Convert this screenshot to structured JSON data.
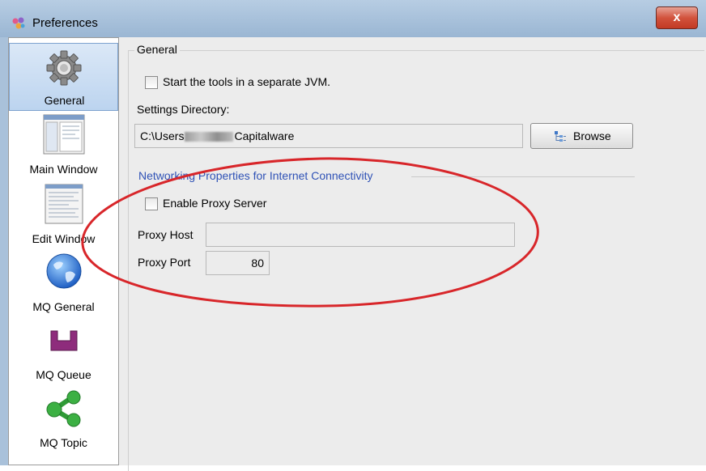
{
  "window": {
    "title": "Preferences",
    "close_label": "x"
  },
  "sidebar": {
    "items": [
      {
        "label": "General",
        "icon": "gear-icon",
        "selected": true
      },
      {
        "label": "Main Window",
        "icon": "main-window-icon",
        "selected": false
      },
      {
        "label": "Edit Window",
        "icon": "edit-window-icon",
        "selected": false
      },
      {
        "label": "MQ General",
        "icon": "globe-icon",
        "selected": false
      },
      {
        "label": "MQ Queue",
        "icon": "queue-icon",
        "selected": false
      },
      {
        "label": "MQ Topic",
        "icon": "topic-icon",
        "selected": false
      }
    ]
  },
  "general": {
    "group_title": "General",
    "separate_jvm_label": "Start the tools in a separate JVM.",
    "separate_jvm_checked": false,
    "settings_dir_label": "Settings Directory:",
    "settings_dir_prefix": "C:\\Users",
    "settings_dir_suffix": "Capitalware",
    "browse_label": "Browse"
  },
  "networking": {
    "section_title": "Networking Properties for Internet Connectivity",
    "enable_proxy_label": "Enable Proxy Server",
    "enable_proxy_checked": false,
    "proxy_host_label": "Proxy Host",
    "proxy_host_value": "",
    "proxy_port_label": "Proxy Port",
    "proxy_port_value": "80"
  },
  "colors": {
    "section_title": "#2f52b6",
    "annotation_ellipse": "#d8262a",
    "selected_nav": "#bcd4ef"
  }
}
